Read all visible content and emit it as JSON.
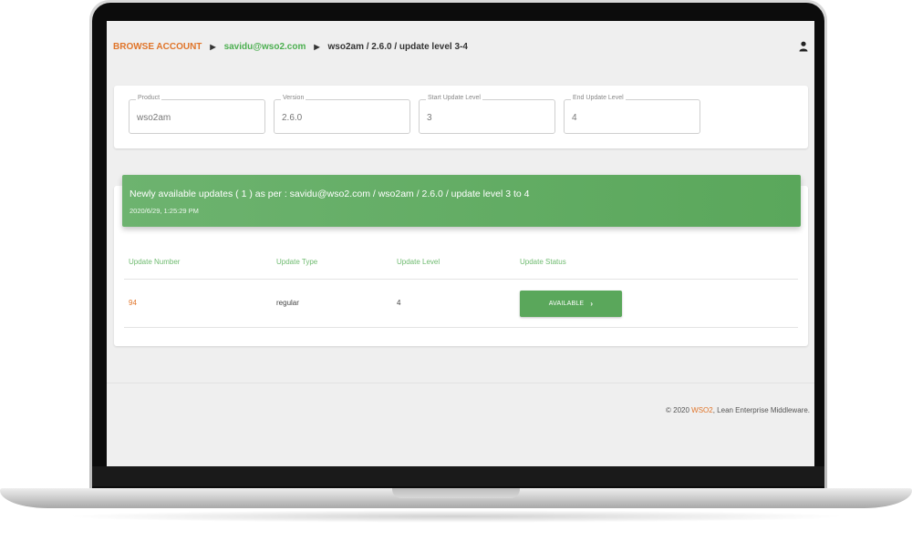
{
  "breadcrumb": {
    "home": "BROWSE ACCOUNT",
    "account": "savidu@wso2.com",
    "current": "wso2am / 2.6.0 / update level 3-4"
  },
  "filters": [
    {
      "label": "Product",
      "value": "wso2am"
    },
    {
      "label": "Version",
      "value": "2.6.0"
    },
    {
      "label": "Start Update Level",
      "value": "3"
    },
    {
      "label": "End Update Level",
      "value": "4"
    }
  ],
  "banner": {
    "title": "Newly available updates ( 1 ) as per : savidu@wso2.com / wso2am / 2.6.0 / update level 3 to 4",
    "timestamp": "2020/6/29, 1:25:29 PM"
  },
  "table": {
    "columns": [
      "Update Number",
      "Update Type",
      "Update Level",
      "Update Status"
    ],
    "rows": [
      {
        "number": "94",
        "type": "regular",
        "level": "4",
        "status": "AVAILABLE"
      }
    ]
  },
  "footer": {
    "prefix": "© 2020 ",
    "brand": "WSO2",
    "suffix": ", Lean Enterprise Middleware."
  },
  "colors": {
    "accent_orange": "#e0752a",
    "accent_green": "#5aa75b"
  },
  "icons": {
    "breadcrumb_separator": "caret-right-icon",
    "user": "user-icon",
    "button_chevron": "chevron-right-icon"
  }
}
